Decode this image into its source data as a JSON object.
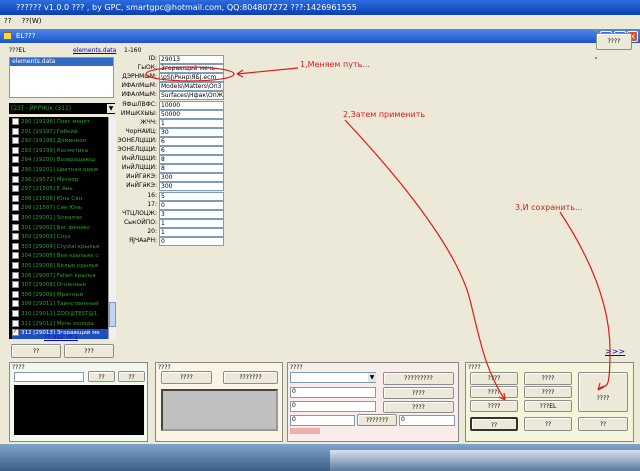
{
  "window_title": "?????? v1.0.0 ??? , by GPC, smartgpc@hotmail.com, QQ:804807272 ???:1426961555",
  "menu": [
    "??",
    "??(W)"
  ],
  "inner_title": "EL???",
  "left": {
    "file_label": "???EL",
    "file_link": "elements.data",
    "file_list": [
      "elements.data"
    ],
    "dropdown": "[23] - ЙРРЖ/к (311)",
    "items": [
      {
        "id": "290",
        "code": "[19196]",
        "name": "Пояс монет"
      },
      {
        "id": "291",
        "code": "[19197]",
        "name": "Гибкий"
      },
      {
        "id": "292",
        "code": "[19198]",
        "name": "Доминион"
      },
      {
        "id": "293",
        "code": "[19199]",
        "name": "Косметика"
      },
      {
        "id": "294",
        "code": "[19200]",
        "name": "Возвращающ"
      },
      {
        "id": "295",
        "code": "[19201]",
        "name": "Цветная одеж"
      },
      {
        "id": "296",
        "code": "[19572]",
        "name": "Метеор"
      },
      {
        "id": "297",
        "code": "[21505]",
        "name": "Е Ань"
      },
      {
        "id": "298",
        "code": "[21506]",
        "name": "Юнь Сян"
      },
      {
        "id": "299",
        "code": "[21507]",
        "name": "Сян Юнь"
      },
      {
        "id": "300",
        "code": "[29001]",
        "name": "Streamer"
      },
      {
        "id": "301",
        "code": "[29002]",
        "name": "Бог феникс"
      },
      {
        "id": "302",
        "code": "[29003]",
        "name": "Слух"
      },
      {
        "id": "303",
        "code": "[29004]",
        "name": "Crystal крылья"
      },
      {
        "id": "304",
        "code": "[29005]",
        "name": "Вее крыльях с"
      },
      {
        "id": "305",
        "code": "[29006]",
        "name": "Белые крылья"
      },
      {
        "id": "306",
        "code": "[29007]",
        "name": "Fallen крылья"
      },
      {
        "id": "307",
        "code": "[29008]",
        "name": "Огненные"
      },
      {
        "id": "308",
        "code": "[29009]",
        "name": "Мрачный"
      },
      {
        "id": "309",
        "code": "[29011]",
        "name": "Таинственный"
      },
      {
        "id": "310",
        "code": "[29011]",
        "name": "ZOO@TEST@1"
      },
      {
        "id": "311",
        "code": "[29012]",
        "name": "Мечь холода"
      },
      {
        "id": "312",
        "code": "[29013]",
        "name": "Згорающий ме"
      }
    ],
    "count_label": "??:312 ??:1",
    "btn1": "??",
    "btn2": "???"
  },
  "props": {
    "range": "1-160",
    "rows": [
      {
        "label": "ID:",
        "value": "29013"
      },
      {
        "label": "ГыОК:",
        "value": "Згорающий мечь"
      },
      {
        "label": "ДЭРНМшМ:",
        "value": "\\pSJ\\Ркнр\\ЯБJ.ecm"
      },
      {
        "label": "ИФАлМшМ:",
        "value": "Models\\Matters\\Оп3"
      },
      {
        "label": "ИФАлМшМ:",
        "value": "Surfaces\\Нфак\\ОпЖ"
      },
      {
        "label": "ЯФшЛВФС:",
        "value": "10000"
      },
      {
        "label": "ИМшКХЫЫ:",
        "value": "50000"
      },
      {
        "label": "ЖЧЧ:",
        "value": "1"
      },
      {
        "label": "ЧорНАИЦ:",
        "value": "30"
      },
      {
        "label": "ЭОНЕЛЦЩИ:",
        "value": "6"
      },
      {
        "label": "ЭОНЕЛЦЩИ:",
        "value": "6"
      },
      {
        "label": "ИнЙЛЦЩИ:",
        "value": "8"
      },
      {
        "label": "ИнЙЛЦЩИ:",
        "value": "8"
      },
      {
        "label": "ИнЙГйКЭ:",
        "value": "300"
      },
      {
        "label": "ИнЙГйКЭ:",
        "value": "300"
      },
      {
        "label": "16:",
        "value": "5"
      },
      {
        "label": "17:",
        "value": "0"
      },
      {
        "label": "ЧТЦЛОЦЖ:",
        "value": "3"
      },
      {
        "label": "СыкОЙПО:",
        "value": "1"
      },
      {
        "label": "20:",
        "value": "1"
      },
      {
        "label": "ЯJЧАаРН:",
        "value": "0"
      }
    ]
  },
  "annotations": {
    "a1": "1,Меняем путь...",
    "a2": "2,Затем применить",
    "a3": "3,И сохранить..."
  },
  "more_link": ">>>",
  "bottom": {
    "p1_title": "????",
    "p1_btn1": "??",
    "p1_btn2": "??",
    "p2_title": "????",
    "p2_btn1": "????",
    "p2_btn2": "???????",
    "p3_title": "????",
    "p3_fields": [
      "0",
      "0",
      "0",
      "0"
    ],
    "p3_btn1": "?????????",
    "p3_btn2": "????",
    "p3_btn3": "????",
    "p3_btn4": "???????",
    "p4_title": "????",
    "p4_b1": "????",
    "p4_b2": "????",
    "p4_b3": "????",
    "p4_b4": "????",
    "p4_b5": "????",
    "p4_b6": "???EL",
    "p4_b7": "??",
    "p4_b8": "??",
    "p4_b9": "??",
    "top_right_btn": "????"
  }
}
